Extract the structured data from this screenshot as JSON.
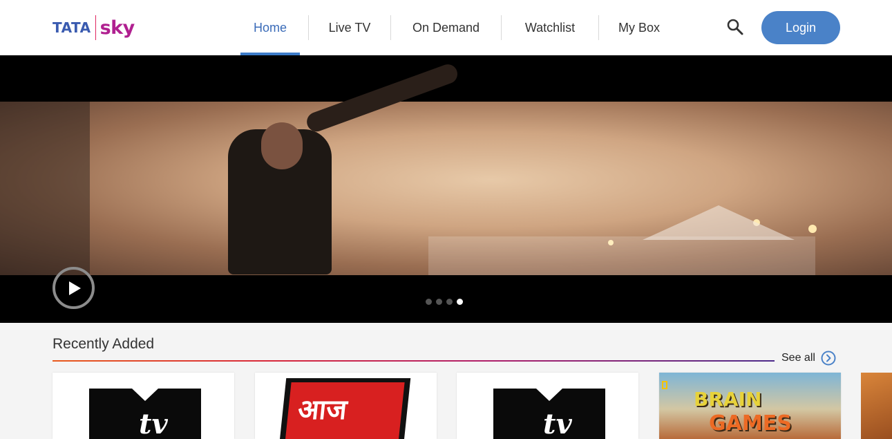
{
  "header": {
    "logo": {
      "brand": "TATA",
      "product": "sky"
    },
    "nav": [
      {
        "label": "Home",
        "active": true
      },
      {
        "label": "Live TV",
        "active": false
      },
      {
        "label": "On Demand",
        "active": false
      },
      {
        "label": "Watchlist",
        "active": false
      },
      {
        "label": "My Box",
        "active": false
      }
    ],
    "search_icon": "search-icon",
    "login_label": "Login"
  },
  "hero": {
    "slides_total": 4,
    "active_slide": 4,
    "play_icon": "play-icon"
  },
  "recently_added": {
    "title": "Recently Added",
    "see_all_label": "See all",
    "see_all_icon": "chevron-right-circle-icon",
    "items": [
      {
        "logo": "MTV",
        "logo_text": "tv"
      },
      {
        "logo": "Aaj Tak",
        "logo_text": "आज"
      },
      {
        "logo": "MTV",
        "logo_text": "tv"
      },
      {
        "logo": "Brain Games",
        "logo_text": "BRAIN",
        "logo_text2": "GAMES"
      }
    ]
  },
  "colors": {
    "accent": "#4a82c8",
    "active_nav": "#3a6bb8",
    "logo_blue": "#3a5bb0",
    "logo_magenta": "#b02090"
  }
}
